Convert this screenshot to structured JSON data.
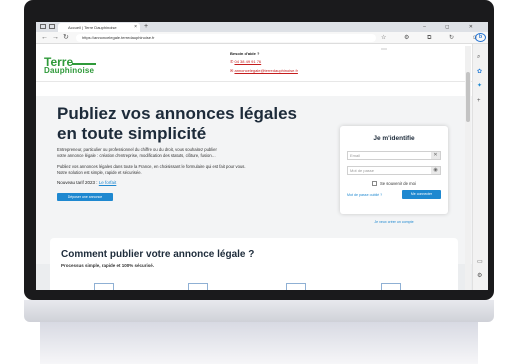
{
  "browser": {
    "tab_title": "Accueil | Terre Dauphinoise",
    "tab_close": "×",
    "new_tab": "+",
    "window_controls": "– ◻ ✕",
    "url": "https://annoncelegale.terredauphinoise.fr",
    "right_toolbar_icons": "☆ ⚙ ⧉ ↻ ☺ ⋯"
  },
  "header": {
    "logo_line1": "Terre",
    "logo_line2": "Dauphinoise",
    "help_title": "Besoin d'aide ?",
    "phone": "04 38 49 91 76",
    "email": "annoncelegale@terredauphinoise.fr"
  },
  "hero": {
    "title_line1": "Publiez vos annonces légales",
    "title_line2": "en toute simplicité",
    "desc_line1": "Entrepreneur, particulier ou professionnel du chiffre ou du droit, vous souhaitez publier",
    "desc_line2": "votre annonce légale : création d'entreprise, modification des statuts, clôture, fusion…",
    "desc2_line1": "Publiez vos annonces légales dans toute la France, en choisissant le formulaire qui est fait pour vous.",
    "desc2_line2": "Notre solution est simple, rapide et sécurisée.",
    "tariff_label": "Nouveau tarif 2023 :",
    "tariff_link": "Le forfait",
    "cta": "Déposer une annonce"
  },
  "login": {
    "title": "Je m'identifie",
    "email_placeholder": "Email",
    "password_placeholder": "Mot de passe",
    "remember": "Se souvenir de moi",
    "forgot": "Mot de passe oublié ?",
    "submit": "Me connecter",
    "create": "Je veux créer un compte"
  },
  "section2": {
    "title": "Comment publier votre annonce légale ?",
    "subtitle": "Processus simple, rapide et 100% sécurisé."
  },
  "colors": {
    "brand_green": "#2f9a3a",
    "brand_red": "#c51d1d",
    "accent_blue": "#1e88d0",
    "heading_dark": "#1d2b3a"
  }
}
